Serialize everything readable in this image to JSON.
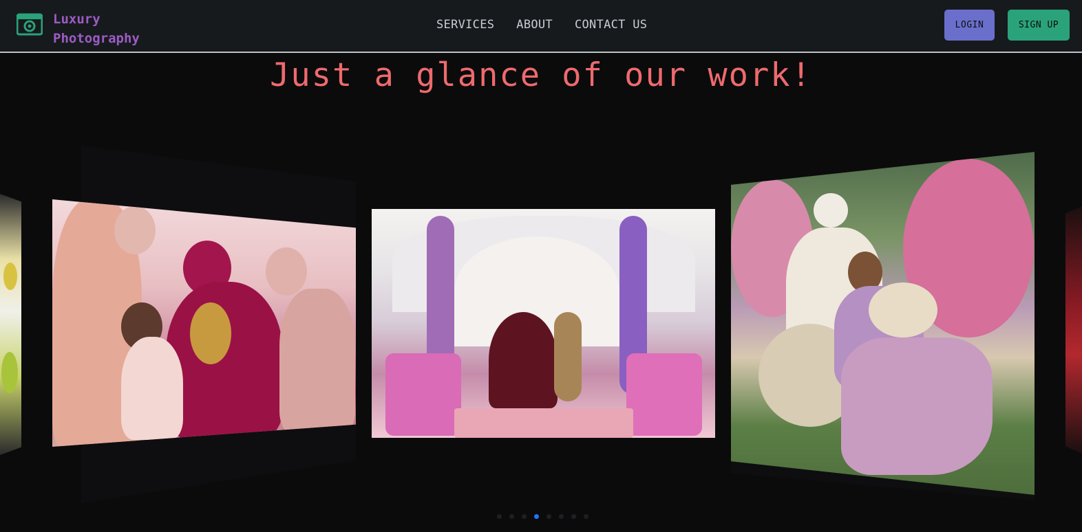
{
  "brand": {
    "name": "Luxury Photography",
    "icon": "camera-icon",
    "color": "#9b5cc4"
  },
  "nav": {
    "links": [
      "SERVICES",
      "ABOUT",
      "CONTACT US"
    ]
  },
  "auth": {
    "login_label": "LOGIN",
    "signup_label": "SIGN UP",
    "login_color": "#6a6fcc",
    "signup_color": "#2aa27a"
  },
  "hero": {
    "heading": "Just a glance of our work!",
    "heading_color": "#ee6a6e"
  },
  "carousel": {
    "slides": [
      {
        "name": "slide-far-left",
        "subject": "party photo"
      },
      {
        "name": "slide-left",
        "subject": "bride with family"
      },
      {
        "name": "slide-center",
        "subject": "couple under floral mandap"
      },
      {
        "name": "slide-right",
        "subject": "couple seated in garden"
      },
      {
        "name": "slide-far-right",
        "subject": "bride in red"
      }
    ],
    "dot_count": 8,
    "active_dot": 3,
    "active_color": "#1e74ff"
  }
}
